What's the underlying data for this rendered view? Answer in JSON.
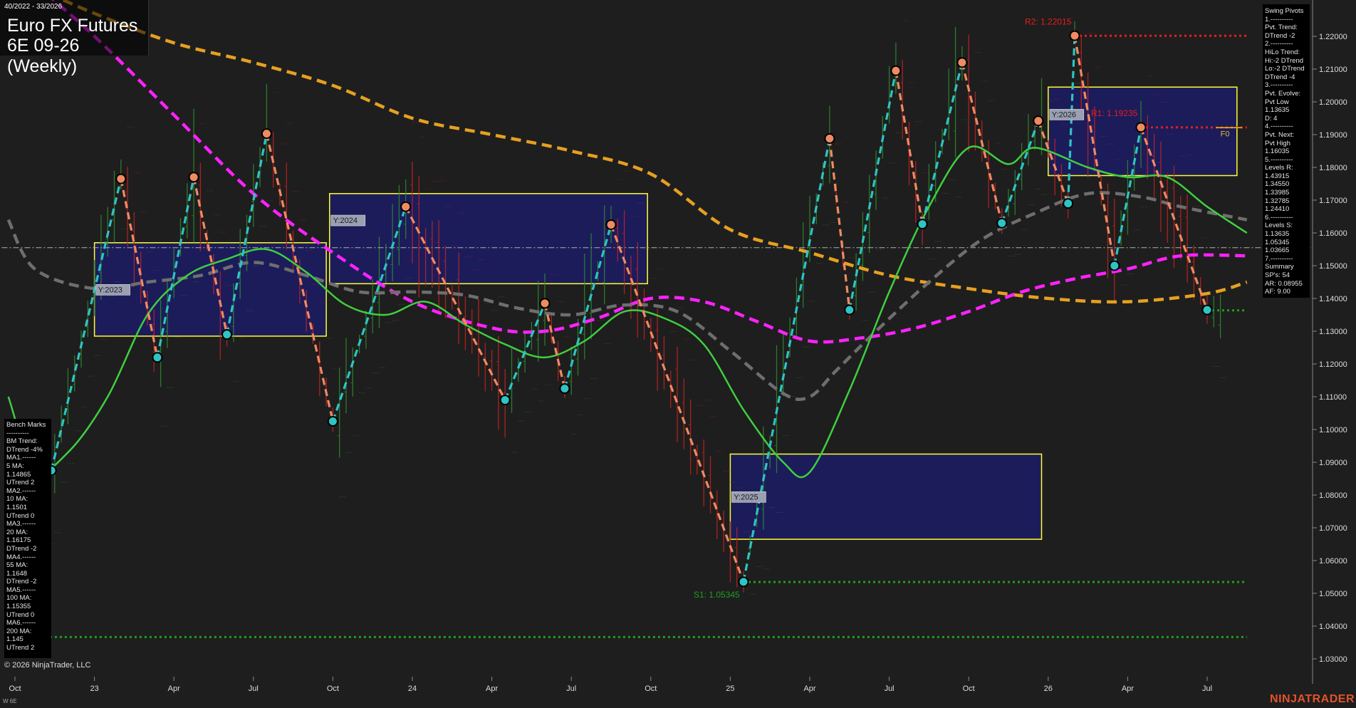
{
  "header": {
    "date_range": "40/2022 - 33/2026",
    "instrument_name": "Euro FX Futures",
    "instrument_code": "6E 09-26 (Weekly)"
  },
  "copyright": "© 2026 NinjaTrader, LLC",
  "footer_left": "W 6E",
  "brand": "NINJATRADER",
  "colors": {
    "background": "#1e1e1e",
    "up_bar": "#2e8b2e",
    "down_bar": "#c42222",
    "swing_up": "#2ec4c4",
    "swing_down": "#f08a62",
    "ma_fast": "#3fcf3f",
    "ma_gray": "#6e6e6e",
    "ma_magenta": "#ff22ff",
    "ma_orange": "#e6a020",
    "zone_fill": "#1c1c66",
    "zone_border": "#ffff33",
    "resistance": "#e61d1d",
    "support": "#1f9e1f"
  },
  "swing_panel": {
    "lines": [
      "Swing Pivots",
      "1.----------",
      "Pvt. Trend:",
      "DTrend -2",
      "2.----------",
      "HiLo Trend:",
      "Hi:-2 DTrend",
      "Lo:-2 DTrend",
      "DTrend -4",
      "3.----------",
      "Pvt. Evolve:",
      "Pvt Low",
      "1.13635",
      "D: 4",
      "4.----------",
      "Pvt. Next:",
      "Pvt High",
      "1.16035",
      "5.----------",
      "Levels R:",
      "1.43915",
      "1.34550",
      "1.33985",
      "1.32785",
      "1.24410",
      "6.----------",
      "Levels S:",
      "1.13635",
      "1.05345",
      "1.03665",
      "7.----------",
      "Summary",
      "SP's: 54",
      "AR: 0.08955",
      "AF: 9.00"
    ]
  },
  "bench_panel": {
    "lines": [
      "Bench Marks",
      "----------",
      "BM Trend:",
      "DTrend -4%",
      "MA1.------",
      "5 MA:",
      "1.14865",
      "UTrend 2",
      "MA2.------",
      "10 MA:",
      "1.1501",
      "UTrend 0",
      "MA3.------",
      "20 MA:",
      "1.16175",
      "DTrend -2",
      "MA4.------",
      "55 MA:",
      "1.1648",
      "DTrend -2",
      "MA5.------",
      "100 MA:",
      "1.15355",
      "UTrend 0",
      "MA6.------",
      "200 MA:",
      "1.145",
      "UTrend 2"
    ]
  },
  "chart_data": {
    "type": "line",
    "title": "Euro FX Futures",
    "subtitle": "6E 09-26 (Weekly)",
    "ylim": [
      1.025,
      1.2305
    ],
    "y_ticks": [
      1.03,
      1.04,
      1.05,
      1.06,
      1.07,
      1.08,
      1.09,
      1.1,
      1.11,
      1.12,
      1.13,
      1.14,
      1.15,
      1.16,
      1.17,
      1.18,
      1.19,
      1.2,
      1.21,
      1.22
    ],
    "y_tick_labels": [
      "1.03000",
      "1.04000",
      "1.05000",
      "1.06000",
      "1.07000",
      "1.08000",
      "1.09000",
      "1.10000",
      "1.11000",
      "1.12000",
      "1.13000",
      "1.14000",
      "1.15000",
      "1.16000",
      "1.17000",
      "1.18000",
      "1.19000",
      "1.20000",
      "1.21000",
      "1.22000"
    ],
    "x_ticks": [
      0,
      12,
      24,
      36,
      48,
      60,
      72,
      84,
      96,
      108,
      120,
      132,
      144,
      156,
      168,
      180,
      192
    ],
    "x_tick_labels": [
      "Oct",
      "23",
      "Apr",
      "Jul",
      "Oct",
      "24",
      "Apr",
      "Jul",
      "Oct",
      "25",
      "Apr",
      "Jul",
      "Oct",
      "26",
      "Apr",
      "Jul",
      ""
    ],
    "x_range": [
      -2,
      185
    ],
    "current_price": 1.1555,
    "swing_pivots": [
      {
        "x": 5.5,
        "y": 1.0875,
        "type": "low",
        "label": ""
      },
      {
        "x": 16,
        "y": 1.1765,
        "type": "high",
        "label": ""
      },
      {
        "x": 21.5,
        "y": 1.122,
        "type": "low",
        "label": ""
      },
      {
        "x": 27,
        "y": 1.177,
        "type": "high",
        "label": ""
      },
      {
        "x": 32,
        "y": 1.129,
        "type": "low",
        "label": ""
      },
      {
        "x": 38,
        "y": 1.1903,
        "type": "high",
        "label": ""
      },
      {
        "x": 48,
        "y": 1.1025,
        "type": "low",
        "label": ""
      },
      {
        "x": 59,
        "y": 1.168,
        "type": "high",
        "label": ""
      },
      {
        "x": 74,
        "y": 1.109,
        "type": "low",
        "label": ""
      },
      {
        "x": 80,
        "y": 1.1385,
        "type": "high",
        "label": ""
      },
      {
        "x": 83,
        "y": 1.1125,
        "type": "low",
        "label": ""
      },
      {
        "x": 90,
        "y": 1.1625,
        "type": "high",
        "label": ""
      },
      {
        "x": 110,
        "y": 1.0535,
        "type": "low",
        "label": ""
      },
      {
        "x": 123,
        "y": 1.1888,
        "type": "high",
        "label": ""
      },
      {
        "x": 126,
        "y": 1.1365,
        "type": "low",
        "label": ""
      },
      {
        "x": 133,
        "y": 1.2095,
        "type": "high",
        "label": ""
      },
      {
        "x": 137,
        "y": 1.1627,
        "type": "low",
        "label": ""
      },
      {
        "x": 143,
        "y": 1.212,
        "type": "high",
        "label": ""
      },
      {
        "x": 149,
        "y": 1.163,
        "type": "low",
        "label": ""
      },
      {
        "x": 154.5,
        "y": 1.1942,
        "type": "high",
        "label": ""
      },
      {
        "x": 159,
        "y": 1.169,
        "type": "low",
        "label": ""
      },
      {
        "x": 160,
        "y": 1.2202,
        "type": "high",
        "label": ""
      },
      {
        "x": 166,
        "y": 1.15,
        "type": "low",
        "label": ""
      },
      {
        "x": 170,
        "y": 1.1922,
        "type": "high",
        "label": ""
      },
      {
        "x": 180,
        "y": 1.1365,
        "type": "low",
        "label": ""
      }
    ],
    "moving_averages": [
      {
        "color": "#e6a020",
        "dash": "long",
        "values": [
          [
            3,
            1.235
          ],
          [
            12,
            1.227
          ],
          [
            24,
            1.218
          ],
          [
            36,
            1.212
          ],
          [
            48,
            1.205
          ],
          [
            60,
            1.195
          ],
          [
            72,
            1.19
          ],
          [
            84,
            1.185
          ],
          [
            96,
            1.178
          ],
          [
            108,
            1.161
          ],
          [
            120,
            1.154
          ],
          [
            132,
            1.147
          ],
          [
            144,
            1.143
          ],
          [
            156,
            1.14
          ],
          [
            168,
            1.139
          ],
          [
            180,
            1.1415
          ],
          [
            186,
            1.145
          ]
        ]
      },
      {
        "color": "#ff22ff",
        "dash": "long",
        "values": [
          [
            3,
            1.236
          ],
          [
            12,
            1.22
          ],
          [
            24,
            1.196
          ],
          [
            36,
            1.172
          ],
          [
            48,
            1.154
          ],
          [
            60,
            1.139
          ],
          [
            72,
            1.131
          ],
          [
            80,
            1.13
          ],
          [
            88,
            1.134
          ],
          [
            96,
            1.14
          ],
          [
            104,
            1.139
          ],
          [
            112,
            1.133
          ],
          [
            120,
            1.127
          ],
          [
            128,
            1.128
          ],
          [
            136,
            1.131
          ],
          [
            144,
            1.136
          ],
          [
            152,
            1.142
          ],
          [
            160,
            1.146
          ],
          [
            168,
            1.149
          ],
          [
            176,
            1.153
          ],
          [
            186,
            1.153
          ]
        ]
      },
      {
        "color": "#6e6e6e",
        "dash": "long",
        "values": [
          [
            -1,
            1.164
          ],
          [
            3,
            1.149
          ],
          [
            12,
            1.143
          ],
          [
            20,
            1.145
          ],
          [
            28,
            1.147
          ],
          [
            36,
            1.151
          ],
          [
            44,
            1.147
          ],
          [
            52,
            1.142
          ],
          [
            60,
            1.142
          ],
          [
            68,
            1.141
          ],
          [
            76,
            1.137
          ],
          [
            84,
            1.135
          ],
          [
            92,
            1.138
          ],
          [
            100,
            1.136
          ],
          [
            108,
            1.124
          ],
          [
            116,
            1.111
          ],
          [
            120,
            1.11
          ],
          [
            124,
            1.118
          ],
          [
            130,
            1.13
          ],
          [
            138,
            1.145
          ],
          [
            146,
            1.158
          ],
          [
            154,
            1.166
          ],
          [
            162,
            1.172
          ],
          [
            170,
            1.171
          ],
          [
            176,
            1.168
          ],
          [
            186,
            1.164
          ]
        ]
      },
      {
        "color": "#3fcf3f",
        "dash": "solid",
        "values": [
          [
            -1,
            1.11
          ],
          [
            3,
            1.088
          ],
          [
            8,
            1.093
          ],
          [
            14,
            1.11
          ],
          [
            20,
            1.135
          ],
          [
            26,
            1.147
          ],
          [
            32,
            1.152
          ],
          [
            38,
            1.155
          ],
          [
            44,
            1.148
          ],
          [
            50,
            1.138
          ],
          [
            56,
            1.135
          ],
          [
            62,
            1.139
          ],
          [
            68,
            1.132
          ],
          [
            74,
            1.126
          ],
          [
            80,
            1.122
          ],
          [
            86,
            1.127
          ],
          [
            92,
            1.136
          ],
          [
            98,
            1.134
          ],
          [
            104,
            1.126
          ],
          [
            110,
            1.106
          ],
          [
            116,
            1.09
          ],
          [
            120,
            1.087
          ],
          [
            126,
            1.112
          ],
          [
            132,
            1.142
          ],
          [
            138,
            1.168
          ],
          [
            144,
            1.186
          ],
          [
            150,
            1.181
          ],
          [
            154,
            1.186
          ],
          [
            162,
            1.18
          ],
          [
            168,
            1.177
          ],
          [
            174,
            1.177
          ],
          [
            180,
            1.168
          ],
          [
            186,
            1.16
          ]
        ]
      }
    ],
    "zones": [
      {
        "label": "Y:2023",
        "x1": 12,
        "x2": 47,
        "y1": 1.1285,
        "y2": 1.157
      },
      {
        "label": "Y:2024",
        "x1": 47.5,
        "x2": 95.5,
        "y1": 1.1445,
        "y2": 1.172
      },
      {
        "label": "Y:2025",
        "x1": 108,
        "x2": 155,
        "y1": 1.0665,
        "y2": 1.0925
      },
      {
        "label": "Y:2026",
        "x1": 156,
        "x2": 184.5,
        "y1": 1.1775,
        "y2": 1.2045
      }
    ],
    "levels": [
      {
        "label": "R2: 1.22015",
        "value": 1.22015,
        "x1": 160,
        "x2": 186,
        "color": "#e61d1d"
      },
      {
        "label": "R1: 1.19235",
        "value": 1.1922,
        "x1": 170,
        "x2": 186,
        "color": "#e61d1d"
      },
      {
        "label": "S1: 1.05345",
        "value": 1.05345,
        "x1": 110,
        "x2": 186,
        "color": "#1f9e1f"
      },
      {
        "label": "",
        "value": 1.03665,
        "x1": 3,
        "x2": 186,
        "color": "#1f9e1f"
      },
      {
        "label": "",
        "value": 1.13635,
        "x1": 180,
        "x2": 186,
        "color": "#1f9e1f"
      }
    ],
    "extra_labels": [
      {
        "text": "F0",
        "x": 182,
        "y": 1.1895,
        "color": "#e6c020"
      }
    ]
  }
}
